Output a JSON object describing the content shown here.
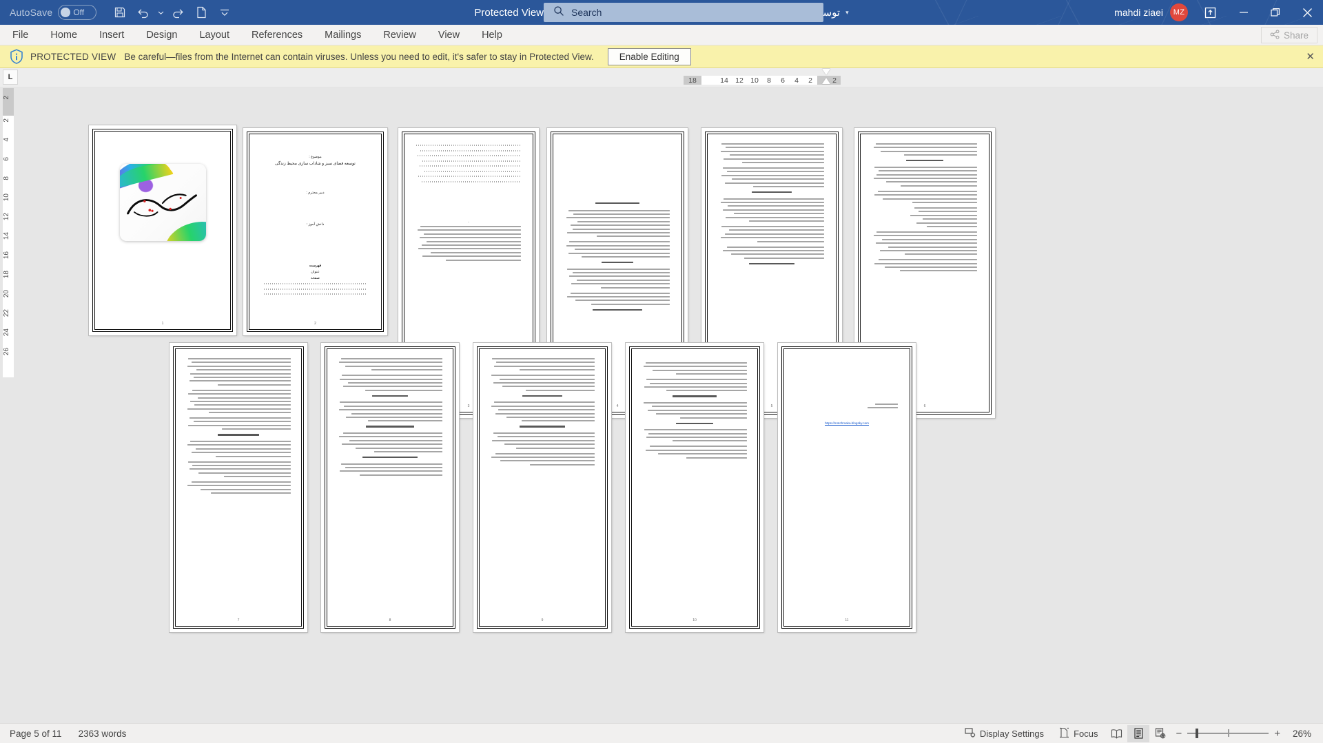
{
  "titlebar": {
    "autosave_label": "AutoSave",
    "autosave_state": "Off",
    "doc_title": "توسعه فضای سبز و شاداب سازی محیط زندگی  -  Protected View  -  Saved to this PC",
    "title_caret": "▾",
    "search_placeholder": "Search",
    "account_name": "mahdi ziaei",
    "account_initials": "MZ",
    "qat": [
      "save-icon",
      "undo-icon",
      "redo-icon",
      "new-doc-icon",
      "customize-qat-icon"
    ],
    "window_controls": [
      "ribbon-display-options",
      "minimize",
      "restore",
      "close"
    ],
    "brand_color": "#2b579a",
    "avatar_color": "#e0483c"
  },
  "ribbon": {
    "tabs": [
      "File",
      "Home",
      "Insert",
      "Design",
      "Layout",
      "References",
      "Mailings",
      "Review",
      "View",
      "Help"
    ],
    "share_label": "Share"
  },
  "protected_view": {
    "icon": "shield-info-icon",
    "strong": "PROTECTED VIEW",
    "message": "Be careful—files from the Internet can contain viruses. Unless you need to edit, it's safer to stay in Protected View.",
    "enable_editing_label": "Enable Editing",
    "close_label": "✕",
    "bar_color": "#f9f2ab"
  },
  "ruler": {
    "tab_stop_glyph": "L",
    "horizontal_ticks": [
      "18",
      "14",
      "12",
      "10",
      "8",
      "6",
      "4",
      "2",
      "2"
    ],
    "vertical_ticks": [
      "2",
      "2",
      "4",
      "6",
      "8",
      "10",
      "12",
      "14",
      "16",
      "18",
      "20",
      "22",
      "24",
      "26"
    ]
  },
  "document": {
    "zoom_percent": "26%",
    "pages": [
      {
        "num": "1",
        "kind": "cover-image"
      },
      {
        "num": "2",
        "kind": "title-page",
        "lines": [
          "موضوع :",
          "توسعه فضای سبز و شاداب سازی محیط زندگی",
          "دبیر محترم :",
          "دانش آموز :"
        ],
        "footer": [
          "فهرست",
          "عنوان",
          "صفحه"
        ]
      },
      {
        "num": "3",
        "kind": "toc"
      },
      {
        "num": "4",
        "kind": "text"
      },
      {
        "num": "5",
        "kind": "text"
      },
      {
        "num": "6",
        "kind": "text"
      },
      {
        "num": "7",
        "kind": "text"
      },
      {
        "num": "8",
        "kind": "text"
      },
      {
        "num": "9",
        "kind": "text"
      },
      {
        "num": "10",
        "kind": "text"
      },
      {
        "num": "11",
        "kind": "link-page",
        "link": "https://motchmaka.blogsky.com"
      }
    ]
  },
  "statusbar": {
    "page_info": "Page 5 of 11",
    "word_count": "2363 words",
    "display_settings_label": "Display Settings",
    "focus_label": "Focus",
    "view_modes": [
      "read-mode-icon",
      "print-layout-icon",
      "web-layout-icon"
    ],
    "active_view": "print-layout-icon",
    "zoom_out": "−",
    "zoom_in": "+",
    "zoom_percent": "26%"
  }
}
